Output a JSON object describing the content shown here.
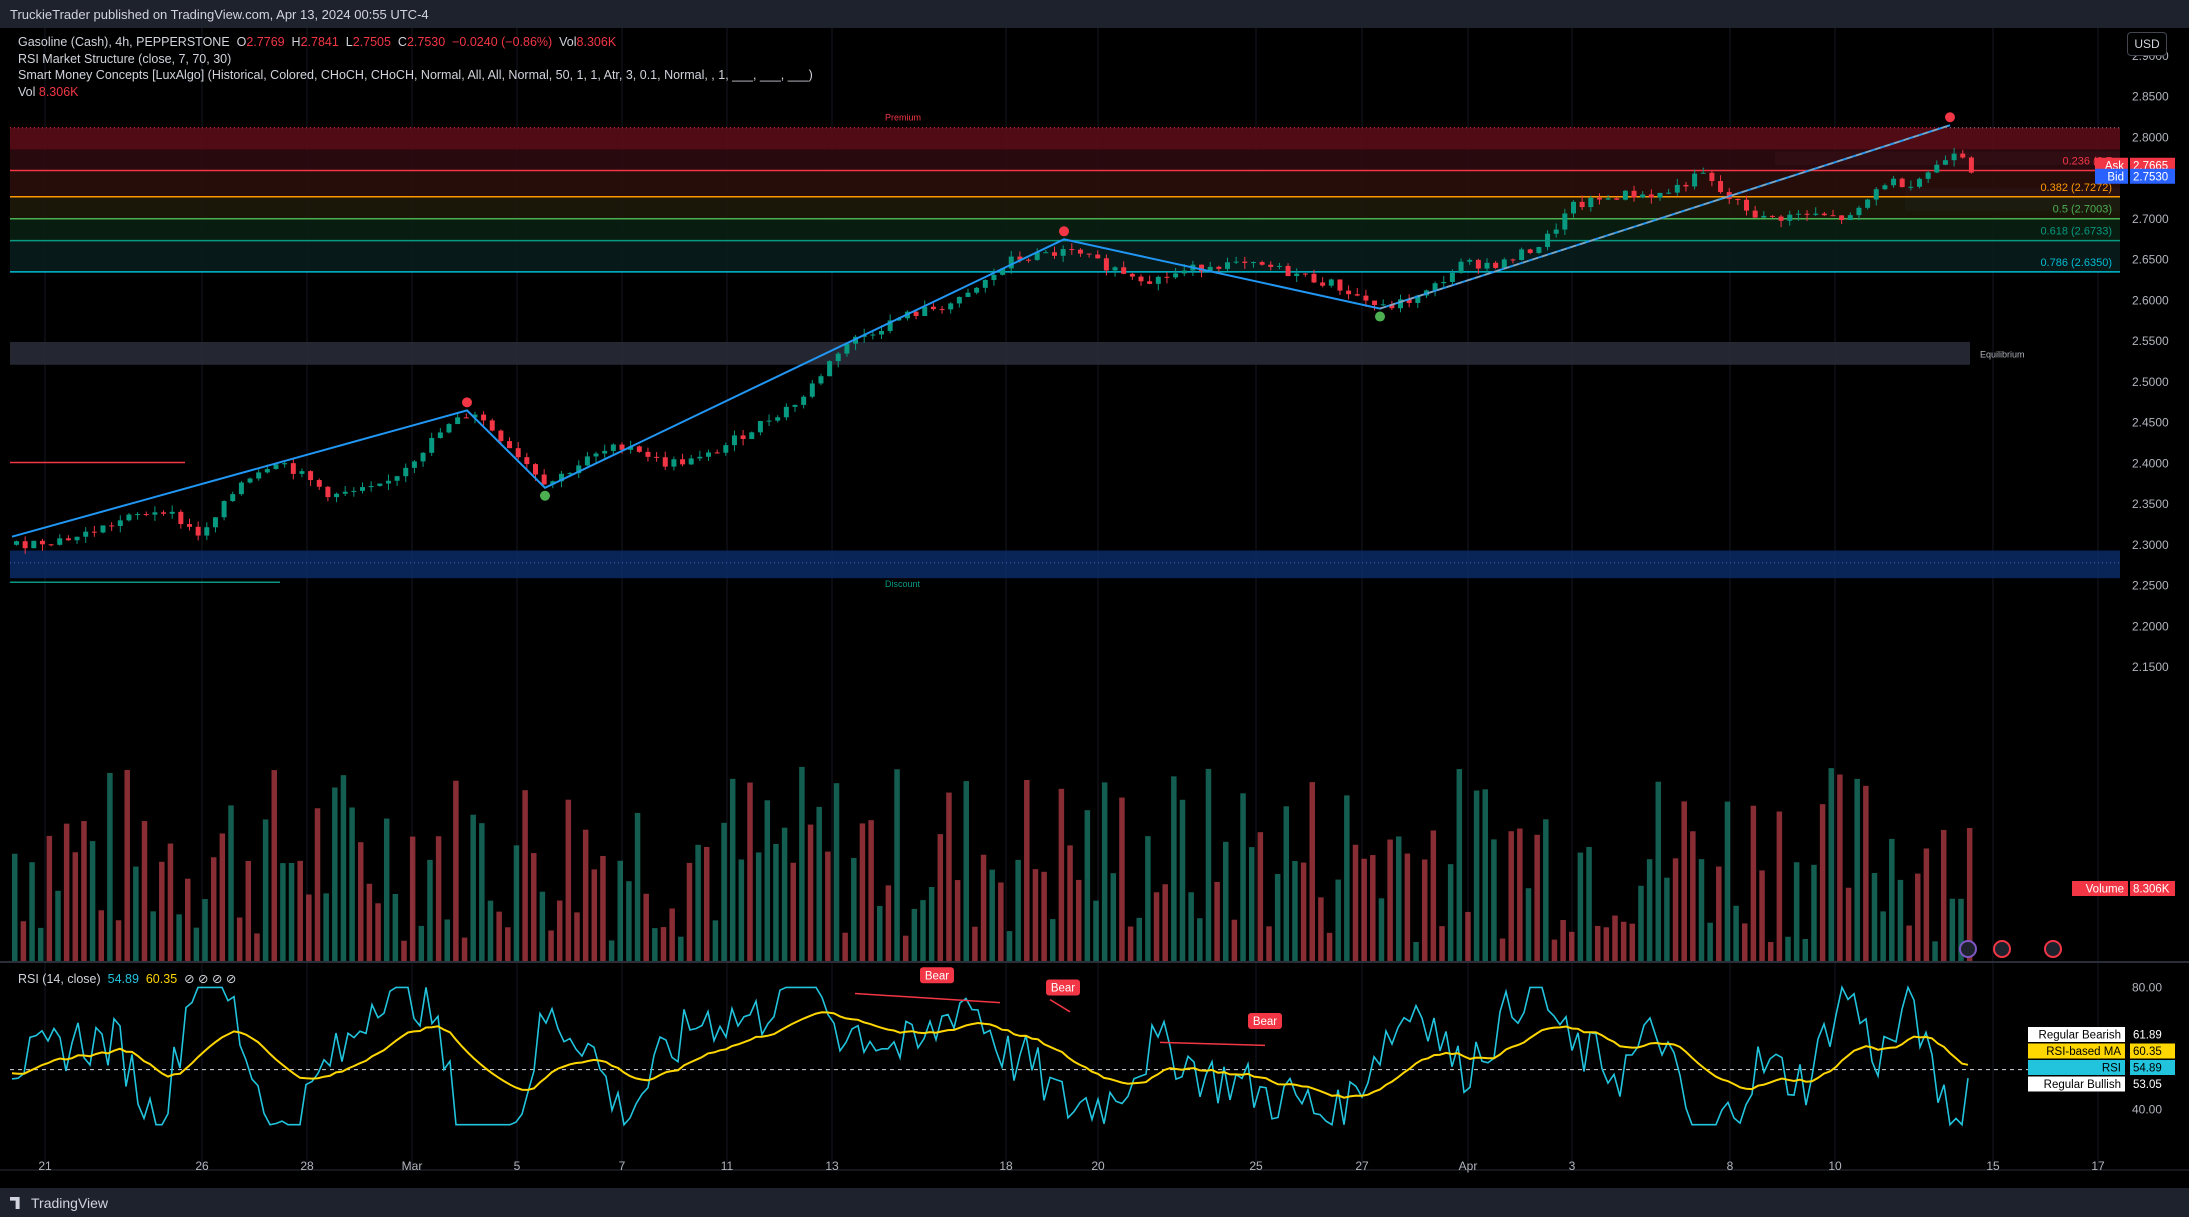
{
  "header": {
    "published": "TruckieTrader published on TradingView.com, Apr 13, 2024 00:55 UTC-4"
  },
  "legend": {
    "symbol": "Gasoline (Cash), 4h, PEPPERSTONE",
    "o_label": "O",
    "o": "2.7769",
    "h_label": "H",
    "h": "2.7841",
    "l_label": "L",
    "l": "2.7505",
    "c_label": "C",
    "c": "2.7530",
    "change": "−0.0240 (−0.86%)",
    "vol_label": "Vol",
    "vol": "8.306K",
    "indicator1": "RSI Market Structure (close, 7, 70, 30)",
    "indicator2": "Smart Money Concepts [LuxAlgo] (Historical, Colored, CHoCH, CHoCH, Normal, All, All, Normal, 50, 1, 1, Atr, 3, 0.1, Normal, , 1, ___, ___, ___)",
    "vol_line_label": "Vol",
    "vol_line_value": "8.306K"
  },
  "currency_button": "USD",
  "price_axis": {
    "ticks": [
      "2.9000",
      "2.8500",
      "2.8000",
      "2.7500",
      "2.7000",
      "2.6500",
      "2.6000",
      "2.5500",
      "2.5000",
      "2.4500",
      "2.4000",
      "2.3500",
      "2.3000",
      "2.2500",
      "2.2000",
      "2.1500"
    ],
    "ask_label": "Ask",
    "ask": "2.7665",
    "bid_label": "Bid",
    "bid": "2.7530",
    "volume_label": "Volume",
    "volume": "8.306K"
  },
  "rsi_axis": {
    "ticks": [
      "80.00",
      "60.00",
      "40.00"
    ]
  },
  "fib_labels": [
    "0.236 (2.7",
    "0.382 (2.7272)",
    "0.5 (2.7003)",
    "0.618 (2.6733)",
    "0.786 (2.6350)"
  ],
  "zones": {
    "premium": "Premium",
    "equilibrium": "Equilibrium",
    "discount": "Discount"
  },
  "rsi_legend": {
    "name": "RSI (14, close)",
    "rsi": "54.89",
    "ma": "60.35",
    "icons": "⊘ ⊘ ⊘ ⊘"
  },
  "rsi_tags": [
    {
      "label": "Regular Bearish",
      "value": "61.89"
    },
    {
      "label": "RSI-based MA",
      "value": "60.35"
    },
    {
      "label": "RSI",
      "value": "54.89"
    },
    {
      "label": "Regular Bullish",
      "value": "53.05"
    }
  ],
  "bear_labels": [
    "Bear",
    "Bear",
    "Bear"
  ],
  "time_axis": [
    "21",
    "26",
    "28",
    "Mar",
    "5",
    "7",
    "11",
    "13",
    "18",
    "20",
    "25",
    "27",
    "Apr",
    "3",
    "8",
    "10",
    "15",
    "17"
  ],
  "footer": {
    "logo": "TradingView"
  },
  "colors": {
    "up": "#089981",
    "down": "#f23645",
    "volume_up": "#22ab94",
    "volume_down": "#f7525f",
    "trendline": "#2196f3",
    "rsi": "#22c4dd",
    "rsi_ma": "#ffd700",
    "bg": "#000000"
  },
  "chart_data": {
    "type": "candlestick",
    "timeframe": "4h",
    "ylim": [
      2.13,
      2.92
    ],
    "rsi_ylim": [
      30,
      88
    ],
    "fib_levels": [
      {
        "ratio": 0.236,
        "price": 2.7594
      },
      {
        "ratio": 0.382,
        "price": 2.7272
      },
      {
        "ratio": 0.5,
        "price": 2.7003
      },
      {
        "ratio": 0.618,
        "price": 2.6733
      },
      {
        "ratio": 0.786,
        "price": 2.635
      }
    ],
    "swing_points": [
      {
        "label": "low",
        "price": 2.305
      },
      {
        "label": "high",
        "price": 2.465
      },
      {
        "label": "low",
        "price": 2.37
      },
      {
        "label": "high",
        "price": 2.675
      },
      {
        "label": "low",
        "price": 2.59
      },
      {
        "label": "high",
        "price": 2.815
      }
    ],
    "last": {
      "open": 2.7769,
      "high": 2.7841,
      "low": 2.7505,
      "close": 2.753,
      "volume": "8.306K"
    }
  }
}
